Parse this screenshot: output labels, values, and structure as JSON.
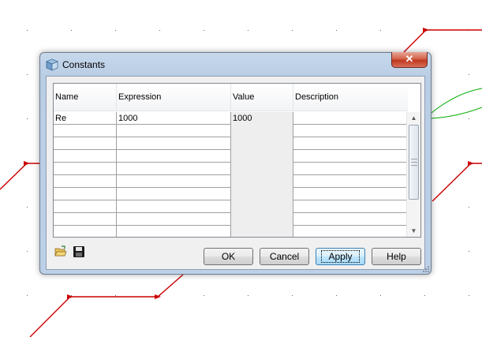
{
  "window": {
    "title": "Constants",
    "close_glyph": "✕"
  },
  "table": {
    "columns": [
      "Name",
      "Expression",
      "Value",
      "Description"
    ],
    "rows": [
      [
        "Re",
        "1000",
        "1000",
        ""
      ],
      [
        "",
        "",
        "",
        ""
      ],
      [
        "",
        "",
        "",
        ""
      ],
      [
        "",
        "",
        "",
        ""
      ],
      [
        "",
        "",
        "",
        ""
      ],
      [
        "",
        "",
        "",
        ""
      ],
      [
        "",
        "",
        "",
        ""
      ],
      [
        "",
        "",
        "",
        ""
      ],
      [
        "",
        "",
        "",
        ""
      ],
      [
        "",
        "",
        "",
        ""
      ]
    ]
  },
  "buttons": {
    "ok": "OK",
    "cancel": "Cancel",
    "apply": "Apply",
    "help": "Help"
  },
  "toolbar": {
    "open_icon": "open-folder-icon",
    "save_icon": "floppy-save-icon"
  },
  "colors": {
    "wire": "#cc0000",
    "wire_green": "#00aa00",
    "accent": "#3c7fb1"
  }
}
